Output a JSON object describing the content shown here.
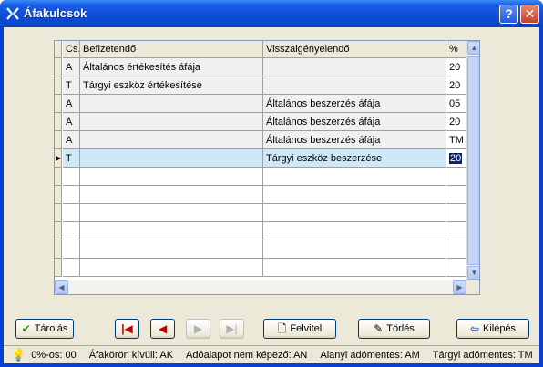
{
  "window": {
    "title": "Áfakulcsok",
    "help_label": "?",
    "close_label": "✕"
  },
  "grid": {
    "columns": [
      "Cs.",
      "Befizetendő",
      "Visszaigényelendő",
      "%"
    ],
    "rows": [
      {
        "cs": "A",
        "befizetendo": "Általános értékesítés áfája",
        "visszaigenyelendo": "",
        "pct": "20"
      },
      {
        "cs": "T",
        "befizetendo": "Tárgyi eszköz értékesítése",
        "visszaigenyelendo": "",
        "pct": "20"
      },
      {
        "cs": "A",
        "befizetendo": "",
        "visszaigenyelendo": "Általános beszerzés áfája",
        "pct": "05"
      },
      {
        "cs": "A",
        "befizetendo": "",
        "visszaigenyelendo": "Általános beszerzés áfája",
        "pct": "20"
      },
      {
        "cs": "A",
        "befizetendo": "",
        "visszaigenyelendo": "Általános beszerzés áfája",
        "pct": "TM"
      },
      {
        "cs": "T",
        "befizetendo": "",
        "visszaigenyelendo": "Tárgyi eszköz beszerzése",
        "pct": "20"
      }
    ],
    "selected_row": 5
  },
  "buttons": {
    "save": "Tárolás",
    "new": "Felvitel",
    "delete": "Törlés",
    "exit": "Kilépés"
  },
  "status": {
    "items": [
      "0%-os: 00",
      "Áfakörön kívüli: AK",
      "Adóalapot nem képező: AN",
      "Alanyi adómentes: AM",
      "Tárgyi adómentes: TM"
    ]
  }
}
